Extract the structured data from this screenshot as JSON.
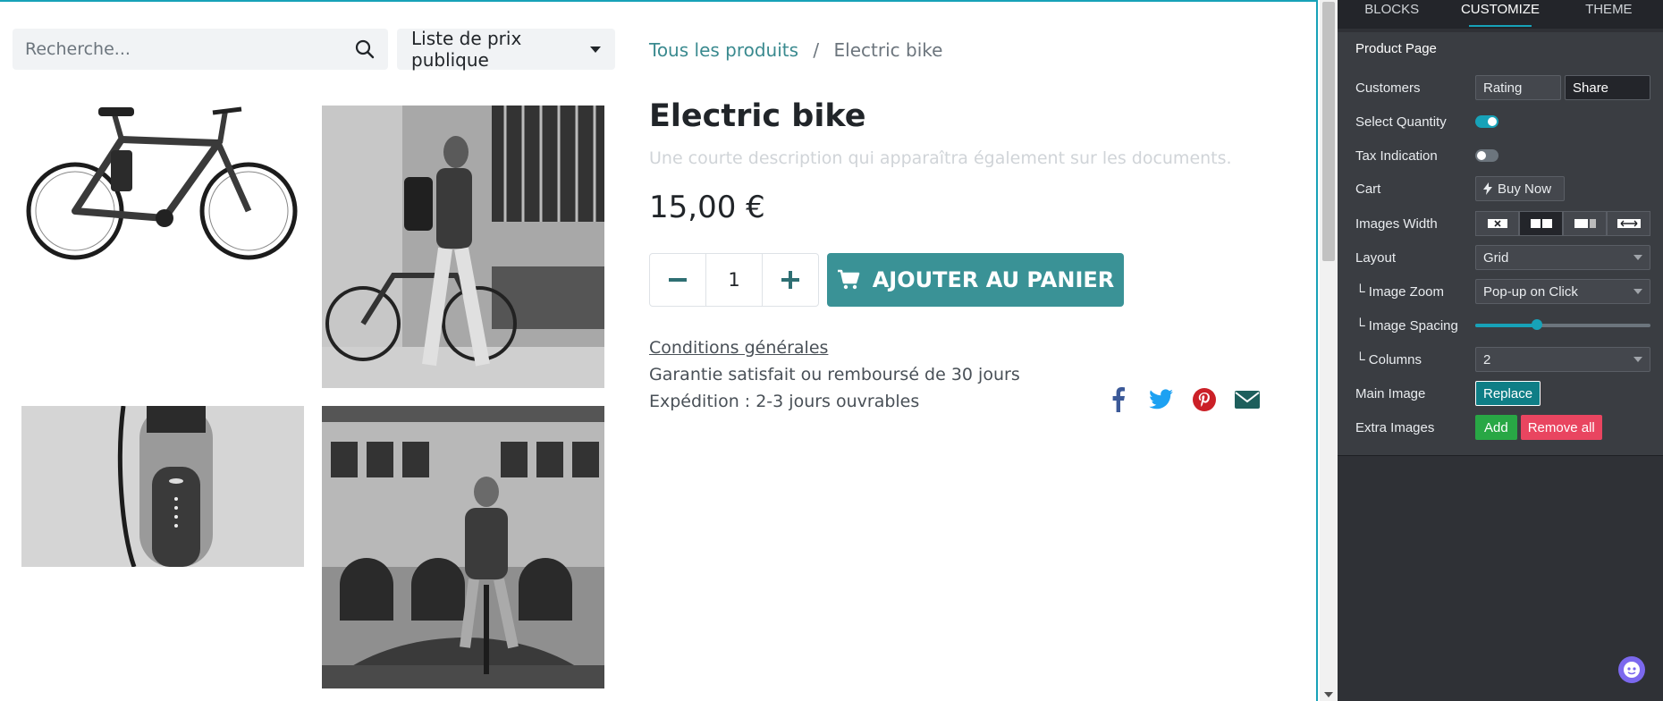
{
  "search": {
    "placeholder": "Recherche..."
  },
  "pricelist": {
    "label": "Liste de prix publique"
  },
  "breadcrumb": {
    "root": "Tous les produits",
    "separator": "/",
    "current": "Electric bike"
  },
  "product": {
    "name": "Electric bike",
    "description": "Une courte description qui apparaîtra également sur les documents.",
    "price": "15,00 €",
    "quantity": "1",
    "add_to_cart": "AJOUTER AU PANIER",
    "terms": "Conditions générales",
    "guarantee": "Garantie satisfait ou remboursé de 30 jours",
    "shipping": "Expédition : 2-3 jours ouvrables"
  },
  "social": [
    "facebook-icon",
    "twitter-icon",
    "pinterest-icon",
    "email-icon"
  ],
  "panel": {
    "tabs": [
      "BLOCKS",
      "CUSTOMIZE",
      "THEME"
    ],
    "active_tab": "CUSTOMIZE",
    "section_title": "Product Page",
    "customers": {
      "label": "Customers",
      "options": [
        "Rating",
        "Share"
      ]
    },
    "select_quantity": {
      "label": "Select Quantity",
      "enabled": true
    },
    "tax_indication": {
      "label": "Tax Indication",
      "enabled": false
    },
    "cart": {
      "label": "Cart",
      "button": "Buy Now"
    },
    "images_width": {
      "label": "Images Width"
    },
    "layout": {
      "label": "Layout",
      "value": "Grid"
    },
    "image_zoom": {
      "label": "└ Image Zoom",
      "value": "Pop-up on Click"
    },
    "image_spacing": {
      "label": "└ Image Spacing",
      "level": 0.35
    },
    "columns": {
      "label": "└ Columns",
      "value": "2"
    },
    "main_image": {
      "label": "Main Image",
      "button": "Replace"
    },
    "extra_images": {
      "label": "Extra Images",
      "add": "Add",
      "remove": "Remove all"
    }
  },
  "colors": {
    "accent": "#3a9296",
    "editor_accent": "#17a2b8",
    "panel_bg": "#2f3136"
  }
}
